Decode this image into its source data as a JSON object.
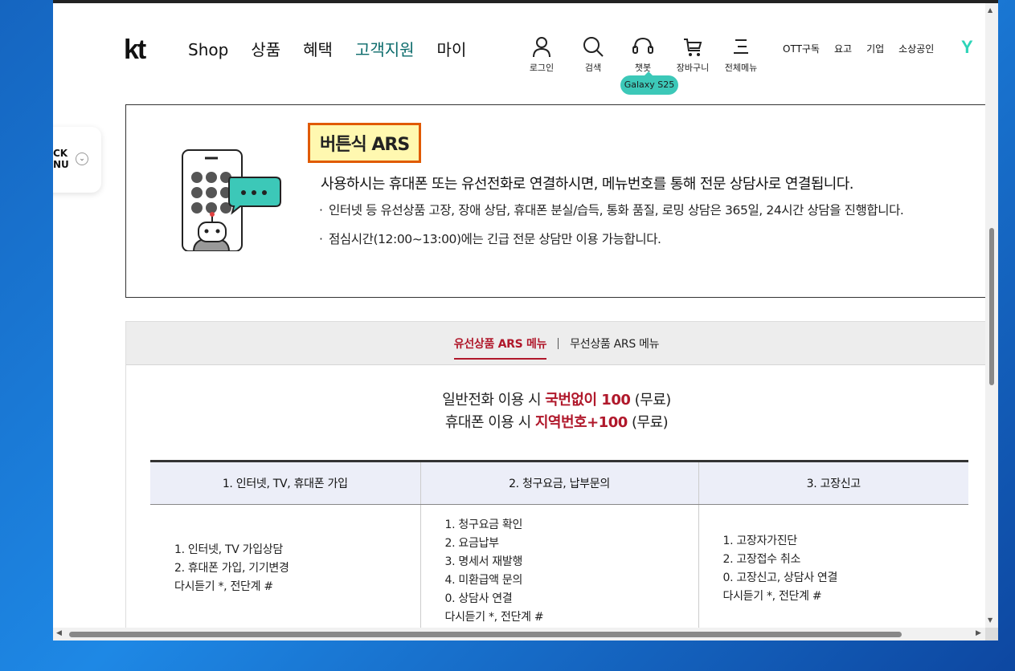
{
  "header": {
    "logo": "kt",
    "nav": [
      "Shop",
      "상품",
      "혜택",
      "고객지원",
      "마이"
    ],
    "active_nav": "고객지원",
    "utils": [
      {
        "icon": "person-icon",
        "label": "로그인"
      },
      {
        "icon": "search-icon",
        "label": "검색"
      },
      {
        "icon": "headset-icon",
        "label": "챗봇"
      },
      {
        "icon": "cart-icon",
        "label": "장바구니"
      },
      {
        "icon": "menu-icon",
        "label": "전체메뉴"
      }
    ],
    "badge": "Galaxy S25",
    "links": [
      "OTT구독",
      "요고",
      "기업",
      "소상공인"
    ],
    "y_logo": "Y"
  },
  "quick_menu": {
    "label_line1": "CK",
    "label_line2": "NU",
    "chevron": "⌄"
  },
  "ars": {
    "title": "버튼식 ARS",
    "description": "사용하시는 휴대폰 또는 유선전화로 연결하시면, 메뉴번호를 통해 전문 상담사로 연결됩니다.",
    "bullets": [
      "인터넷 등 유선상품 고장, 장애 상담, 휴대폰 분실/습득, 통화 품질, 로밍 상담은 365일, 24시간 상담을 진행합니다.",
      "점심시간(12:00~13:00)에는 긴급 전문 상담만 이용 가능합니다."
    ]
  },
  "tabs": {
    "items": [
      "유선상품 ARS 메뉴",
      "무선상품 ARS 메뉴"
    ],
    "active": "유선상품 ARS 메뉴"
  },
  "call_info": {
    "line1_prefix": "일반전화 이용 시 ",
    "line1_highlight": "국번없이 100",
    "line1_suffix": " (무료)",
    "line2_prefix": "휴대폰 이용 시 ",
    "line2_highlight": "지역번호+100",
    "line2_suffix": " (무료)"
  },
  "menu_table": {
    "headers": [
      "1. 인터넷, TV, 휴대폰 가입",
      "2. 청구요금, 납부문의",
      "3. 고장신고"
    ],
    "col1": [
      "1. 인터넷, TV 가입상담",
      "2. 휴대폰 가입, 기기변경",
      "다시듣기 *, 전단계 #"
    ],
    "col2": [
      "1. 청구요금 확인",
      "2. 요금납부",
      "3. 명세서 재발행",
      "4. 미환급액 문의",
      "0. 상담사 연결",
      "다시듣기 *, 전단계 #"
    ],
    "col3": [
      "1. 고장자가진단",
      "2. 고장접수 취소",
      "0. 고장신고, 상담사 연결",
      "다시듣기 *, 전단계 #"
    ]
  },
  "colors": {
    "accent_red": "#b0182b",
    "brand_teal": "#3cc8b8",
    "highlight_orange": "#e05a00"
  }
}
